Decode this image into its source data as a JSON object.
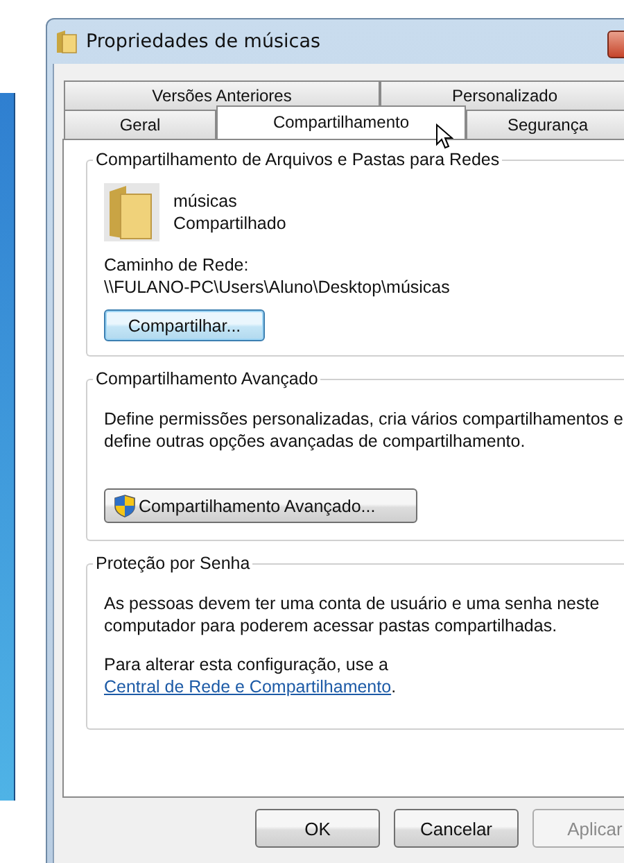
{
  "window": {
    "title": "Propriedades de músicas"
  },
  "tab_rows": [
    {
      "tabs": [
        {
          "label": "Versões Anteriores",
          "selected": false
        },
        {
          "label": "Personalizado",
          "selected": false
        }
      ]
    },
    {
      "tabs": [
        {
          "label": "Geral",
          "selected": false
        },
        {
          "label": "Compartilhamento",
          "selected": true
        },
        {
          "label": "Segurança",
          "selected": false
        }
      ]
    }
  ],
  "network_sharing": {
    "title": "Compartilhamento de Arquivos e Pastas para Redes",
    "folder_name": "músicas",
    "folder_status": "Compartilhado",
    "path_label": "Caminho de Rede:",
    "path": "\\\\FULANO-PC\\Users\\Aluno\\Desktop\\músicas",
    "button": "Compartilhar..."
  },
  "advanced_sharing": {
    "title": "Compartilhamento Avançado",
    "description": "Define permissões personalizadas, cria vários compartilhamentos e define outras opções avançadas de compartilhamento.",
    "button": "Compartilhamento Avançado..."
  },
  "password_protection": {
    "title": "Proteção por Senha",
    "description": "As pessoas devem ter uma conta de usuário e uma senha neste computador para poderem acessar pastas compartilhadas.",
    "link_prefix": "Para alterar esta configuração, use a ",
    "link": "Central de Rede e Compartilhamento",
    "link_suffix": "."
  },
  "buttons": [
    {
      "label": "OK",
      "disabled": false
    },
    {
      "label": "Cancelar",
      "disabled": false
    },
    {
      "label": "Aplicar",
      "disabled": true
    }
  ]
}
